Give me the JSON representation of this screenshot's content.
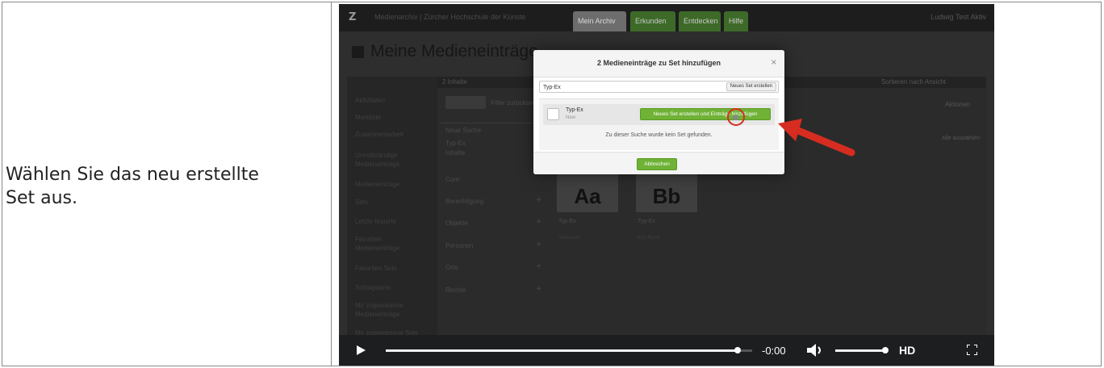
{
  "instruction": {
    "line1": "Wählen Sie das neu erstellte",
    "line2": "Set aus."
  },
  "app": {
    "logo": "Z",
    "topbar_title": "Medienarchiv | Zürcher Hochschule der Künste",
    "tabs": [
      "Mein Archiv",
      "Erkunden",
      "Entdecken",
      "Hilfe"
    ],
    "user": "Ludwig Test Aktiv",
    "page_title": "Meine Medieneinträge",
    "sidebar_items": [
      "Aktivitäten",
      "Merkliste",
      "Zusammenarbeit",
      "Unvollständige Medieneinträge",
      "Medieneinträge",
      "Sets",
      "Letzte Importe",
      "Favoriten Medieneinträge",
      "Favoriten Sets",
      "Schlagworte",
      "Mir zugewiesene Medieneinträge",
      "Mir zugewiesene Sets"
    ],
    "content_bar_left": "2 Inhalte",
    "content_bar_right": "Sortieren nach Ansicht",
    "filter_text": "Filter zurücksetzen",
    "aktionen": "Aktionen",
    "select_all": "Alle auswählen",
    "facets": [
      "Neue Suche",
      "Typ-Ex",
      "Inhalte",
      "Core",
      "Berechtigung",
      "Objekte",
      "Personen",
      "Orte",
      "Rechte"
    ],
    "thumbs": [
      {
        "glyph": "Aa",
        "label": "Typ-Ex",
        "sub": "Sebastian"
      },
      {
        "glyph": "Bb",
        "label": "Typ-Ex",
        "sub": "Karl Ronie"
      }
    ]
  },
  "modal": {
    "title": "2 Medieneinträge zu Set hinzufügen",
    "close": "×",
    "search_value": "Typ-Ex",
    "new_set_button": "Neues Set erstellen",
    "result_name": "Typ-Ex",
    "result_status": "New",
    "create_add_button": "Neues Set erstellen und Einträge hinzufügen",
    "no_set_message": "Zu dieser Suche wurde kein Set gefunden.",
    "cancel_button": "Abbrechen"
  },
  "player": {
    "time": "-0:00",
    "hd": "HD",
    "progress": 0.96,
    "volume": 1.0
  },
  "colors": {
    "green": "#6fb235",
    "annotation_red": "#d62d20",
    "player_bg": "#1d1e1f"
  }
}
